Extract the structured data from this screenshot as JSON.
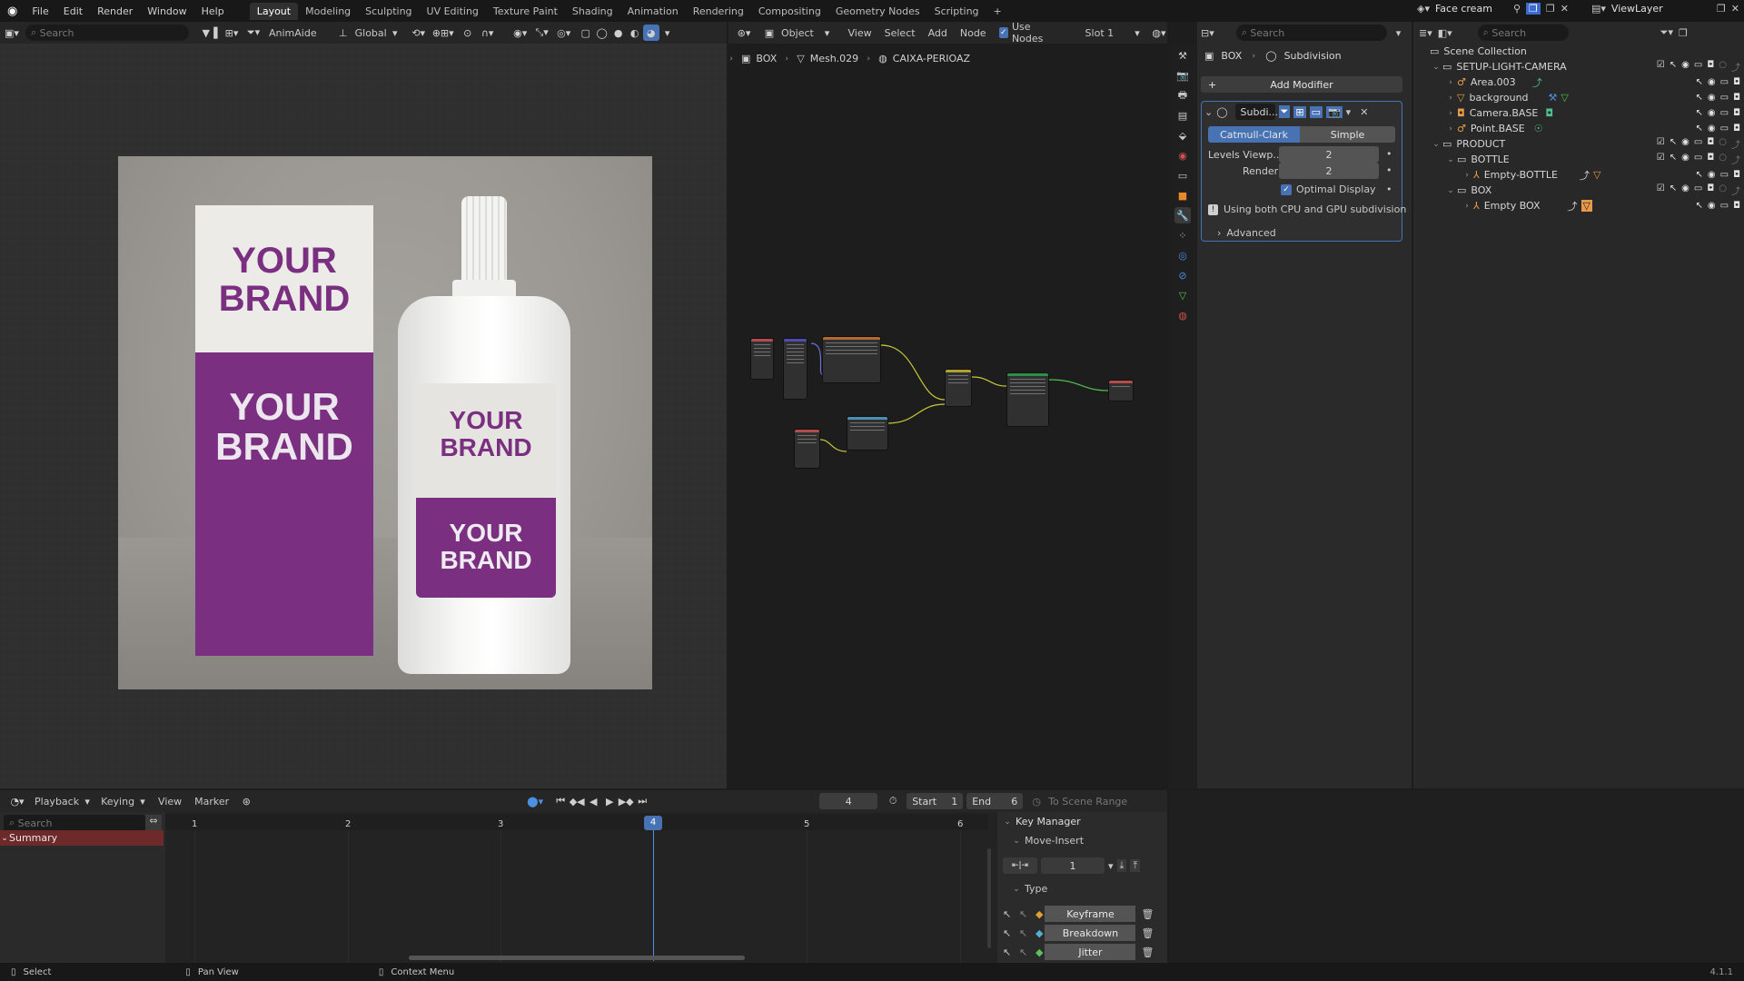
{
  "menus": [
    "File",
    "Edit",
    "Render",
    "Window",
    "Help"
  ],
  "workspaces": [
    "Layout",
    "Modeling",
    "Sculpting",
    "UV Editing",
    "Texture Paint",
    "Shading",
    "Animation",
    "Rendering",
    "Compositing",
    "Geometry Nodes",
    "Scripting"
  ],
  "active_workspace": "Layout",
  "scene_name": "Face cream",
  "view_layer": "ViewLayer",
  "viewport_header": {
    "search_placeholder": "Search",
    "addon": "AnimAide",
    "orientation": "Global"
  },
  "product_image": {
    "box_brand_top": [
      "YOUR",
      "BRAND"
    ],
    "box_brand_bottom": [
      "YOUR",
      "BRAND"
    ],
    "bottle_brand_top": [
      "YOUR",
      "BRAND"
    ],
    "bottle_brand_bottom": [
      "YOUR",
      "BRAND"
    ],
    "colors": {
      "purple": "#7a2f80",
      "bg": "#9b9893"
    }
  },
  "node_editor": {
    "mode": "Object",
    "menus": [
      "View",
      "Select",
      "Add",
      "Node"
    ],
    "use_nodes": "Use Nodes",
    "slot": "Slot 1",
    "breadcrumb": [
      "BOX",
      "Mesh.029",
      "CAIXA-PERIOAZ"
    ]
  },
  "properties": {
    "search_placeholder": "Search",
    "breadcrumb_object": "BOX",
    "breadcrumb_modifier": "Subdivision",
    "add_modifier": "Add Modifier",
    "modifier_name": "Subdi...",
    "tabs": [
      "Catmull-Clark",
      "Simple"
    ],
    "levels_label": "Levels Viewp...",
    "levels_value": "2",
    "render_label": "Render",
    "render_value": "2",
    "optimal_display": "Optimal Display",
    "info": "Using both CPU and GPU subdivision",
    "advanced": "Advanced"
  },
  "outliner": {
    "search_placeholder": "Search",
    "scene_collection": "Scene Collection",
    "items": [
      {
        "label": "SETUP-LIGHT-CAMERA"
      },
      {
        "label": "Area.003"
      },
      {
        "label": "background"
      },
      {
        "label": "Camera.BASE"
      },
      {
        "label": "Point.BASE"
      },
      {
        "label": "PRODUCT"
      },
      {
        "label": "BOTTLE"
      },
      {
        "label": "Empty-BOTTLE"
      },
      {
        "label": "BOX"
      },
      {
        "label": "Empty BOX"
      }
    ]
  },
  "timeline": {
    "menus": [
      "Playback",
      "Keying",
      "View",
      "Marker"
    ],
    "current_frame": "4",
    "start_label": "Start",
    "start": "1",
    "end_label": "End",
    "end": "6",
    "to_scene_range": "To Scene Range",
    "search_placeholder": "Search",
    "summary": "Summary",
    "frames": [
      "1",
      "2",
      "3",
      "4",
      "5",
      "6"
    ]
  },
  "key_manager": {
    "title": "Key Manager",
    "move_insert": "Move-Insert",
    "step_value": "1",
    "type": "Type",
    "types": [
      "Keyframe",
      "Breakdown",
      "Jitter"
    ]
  },
  "statusbar": {
    "select": "Select",
    "pan": "Pan View",
    "context": "Context Menu",
    "version": "4.1.1"
  }
}
